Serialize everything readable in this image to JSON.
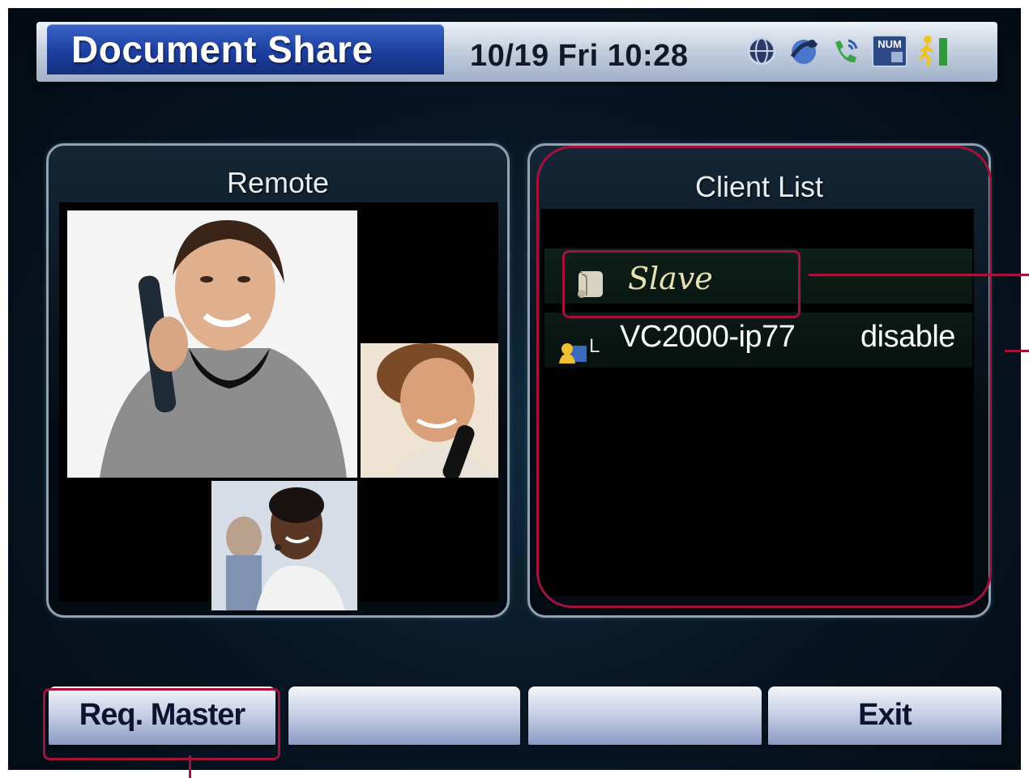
{
  "header": {
    "title": "Document Share",
    "datetime": "10/19 Fri 10:28",
    "status_icons": [
      "globe-icon",
      "network-icon",
      "phone-call-icon",
      "num-lock-icon",
      "exit-person-icon"
    ],
    "num_label": "NUM"
  },
  "remote_panel": {
    "title": "Remote"
  },
  "client_panel": {
    "title": "Client List",
    "role_label": "Slave",
    "clients": [
      {
        "name": "VC2000-ip77",
        "status": "disable",
        "tag": "L"
      }
    ]
  },
  "softkeys": {
    "key1": "Req.  Master",
    "key2": "",
    "key3": "",
    "key4": "Exit"
  },
  "colors": {
    "title_tab": "#1c3f9f",
    "annotation_red": "#a3123a",
    "slave_text": "#e6e2b0"
  }
}
